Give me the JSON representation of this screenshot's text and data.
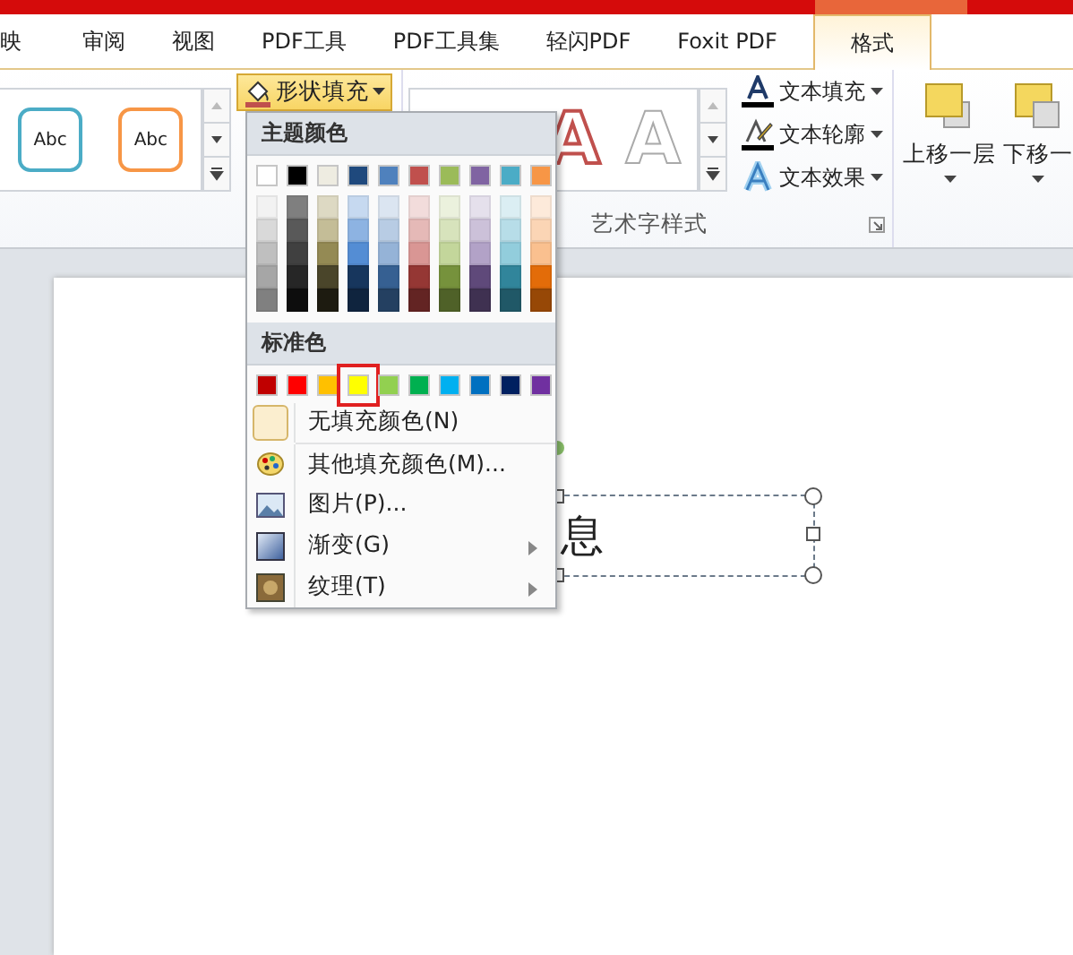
{
  "tabs": [
    {
      "label": "映",
      "selected": false
    },
    {
      "label": "审阅",
      "selected": false
    },
    {
      "label": "视图",
      "selected": false
    },
    {
      "label": "PDF工具",
      "selected": false
    },
    {
      "label": "PDF工具集",
      "selected": false
    },
    {
      "label": "轻闪PDF",
      "selected": false
    },
    {
      "label": "Foxit PDF",
      "selected": false
    },
    {
      "label": "格式",
      "selected": true
    }
  ],
  "ribbon": {
    "shape_styles": [
      {
        "label": "Abc",
        "color": "#4bacc6"
      },
      {
        "label": "Abc",
        "color": "#f79646"
      }
    ],
    "fill_button": {
      "label": "形状填充",
      "active": true
    },
    "wordart_samples": [
      {
        "label": "A",
        "kind": "red-outline"
      },
      {
        "label": "A",
        "kind": "white-outline"
      }
    ],
    "text_buttons": [
      {
        "label": "文本填充",
        "kind": "fill"
      },
      {
        "label": "文本轮廓",
        "kind": "outline"
      },
      {
        "label": "文本效果",
        "kind": "effect"
      }
    ],
    "group_label": "艺术字样式",
    "arrange_buttons": [
      {
        "label": "上移一层"
      },
      {
        "label": "下移一"
      }
    ]
  },
  "fill_menu": {
    "theme_heading": "主题颜色",
    "theme_colors": [
      {
        "color": "#ffffff",
        "shades": [
          {
            "color": "#f2f2f2"
          },
          {
            "color": "#d9d9d9"
          },
          {
            "color": "#bfbfbf"
          },
          {
            "color": "#a6a6a6"
          },
          {
            "color": "#808080"
          }
        ]
      },
      {
        "color": "#000000",
        "shades": [
          {
            "color": "#7f7f7f"
          },
          {
            "color": "#595959"
          },
          {
            "color": "#404040"
          },
          {
            "color": "#262626"
          },
          {
            "color": "#0d0d0d"
          }
        ]
      },
      {
        "color": "#eeece1",
        "shades": [
          {
            "color": "#ddd9c3"
          },
          {
            "color": "#c4bd97"
          },
          {
            "color": "#948a54"
          },
          {
            "color": "#4a452a"
          },
          {
            "color": "#1d1b10"
          }
        ]
      },
      {
        "color": "#1f497d",
        "shades": [
          {
            "color": "#c6d9f0"
          },
          {
            "color": "#8db3e2"
          },
          {
            "color": "#548dd4"
          },
          {
            "color": "#17365d"
          },
          {
            "color": "#0f243e"
          }
        ]
      },
      {
        "color": "#4f81bd",
        "shades": [
          {
            "color": "#dbe5f1"
          },
          {
            "color": "#b8cce4"
          },
          {
            "color": "#95b3d7"
          },
          {
            "color": "#366092"
          },
          {
            "color": "#244061"
          }
        ]
      },
      {
        "color": "#c0504d",
        "shades": [
          {
            "color": "#f2dcdb"
          },
          {
            "color": "#e5b9b7"
          },
          {
            "color": "#d99694"
          },
          {
            "color": "#953734"
          },
          {
            "color": "#632423"
          }
        ]
      },
      {
        "color": "#9bbb59",
        "shades": [
          {
            "color": "#ebf1dd"
          },
          {
            "color": "#d7e3bc"
          },
          {
            "color": "#c3d69b"
          },
          {
            "color": "#76923c"
          },
          {
            "color": "#4f6128"
          }
        ]
      },
      {
        "color": "#8064a2",
        "shades": [
          {
            "color": "#e5e0ec"
          },
          {
            "color": "#ccc1d9"
          },
          {
            "color": "#b2a2c7"
          },
          {
            "color": "#5f497a"
          },
          {
            "color": "#3f3151"
          }
        ]
      },
      {
        "color": "#4bacc6",
        "shades": [
          {
            "color": "#dbeef3"
          },
          {
            "color": "#b7dde8"
          },
          {
            "color": "#92cddc"
          },
          {
            "color": "#31859b"
          },
          {
            "color": "#205867"
          }
        ]
      },
      {
        "color": "#f79646",
        "shades": [
          {
            "color": "#fdeada"
          },
          {
            "color": "#fbd5b5"
          },
          {
            "color": "#fac08f"
          },
          {
            "color": "#e36c09"
          },
          {
            "color": "#974806"
          }
        ]
      }
    ],
    "standard_heading": "标准色",
    "standard_colors": [
      {
        "color": "#c00000",
        "selected": false
      },
      {
        "color": "#ff0000",
        "selected": false
      },
      {
        "color": "#ffc000",
        "selected": false
      },
      {
        "color": "#ffff00",
        "selected": true
      },
      {
        "color": "#92d050",
        "selected": false
      },
      {
        "color": "#00b050",
        "selected": false
      },
      {
        "color": "#00b0f0",
        "selected": false
      },
      {
        "color": "#0070c0",
        "selected": false
      },
      {
        "color": "#002060",
        "selected": false
      },
      {
        "color": "#7030a0",
        "selected": false
      }
    ],
    "no_fill": "无填充颜色(N)",
    "items": [
      {
        "label": "其他填充颜色(M)...",
        "kind": "palette",
        "submenu": false
      },
      {
        "label": "图片(P)...",
        "kind": "picture",
        "submenu": false
      },
      {
        "label": "渐变(G)",
        "kind": "gradient",
        "submenu": true
      },
      {
        "label": "纹理(T)",
        "kind": "texture",
        "submenu": true
      }
    ]
  },
  "slide": {
    "textbox_text": "息"
  }
}
